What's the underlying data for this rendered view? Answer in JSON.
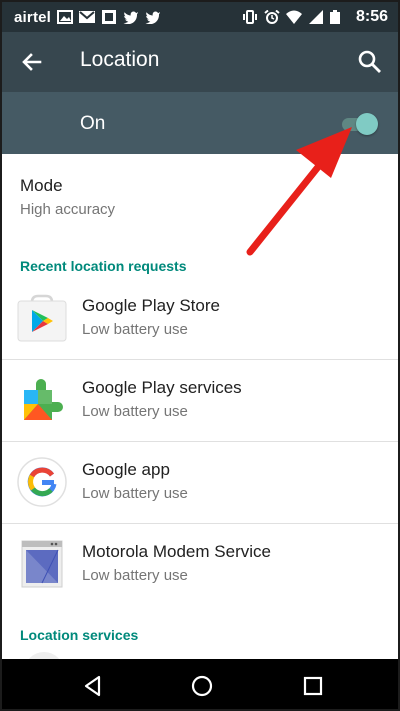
{
  "status_bar": {
    "carrier": "airtel",
    "time": "8:56",
    "left_icons": [
      "image-icon",
      "gmail-icon",
      "app-icon",
      "twitter-icon",
      "twitter-icon"
    ],
    "right_icons": [
      "vibrate-icon",
      "alarm-icon",
      "wifi-icon",
      "signal-icon",
      "battery-icon"
    ]
  },
  "app_bar": {
    "title": "Location",
    "back_icon": "arrow-back-icon",
    "search_icon": "search-icon"
  },
  "master_switch": {
    "label": "On",
    "checked": true,
    "accent_color": "#80cbc4"
  },
  "mode": {
    "title": "Mode",
    "value": "High accuracy"
  },
  "recent_requests": {
    "header": "Recent location requests",
    "header_color": "#00897b",
    "items": [
      {
        "name": "Google Play Store",
        "subtitle": "Low battery use",
        "icon": "play-store-icon"
      },
      {
        "name": "Google Play services",
        "subtitle": "Low battery use",
        "icon": "play-services-icon"
      },
      {
        "name": "Google app",
        "subtitle": "Low battery use",
        "icon": "google-g-icon"
      },
      {
        "name": "Motorola Modem Service",
        "subtitle": "Low battery use",
        "icon": "motorola-modem-icon"
      }
    ]
  },
  "location_services": {
    "header": "Location services"
  },
  "nav_bar": {
    "icons": [
      "nav-back-icon",
      "nav-home-icon",
      "nav-recent-icon"
    ]
  },
  "annotation": {
    "color": "#e8201a"
  }
}
